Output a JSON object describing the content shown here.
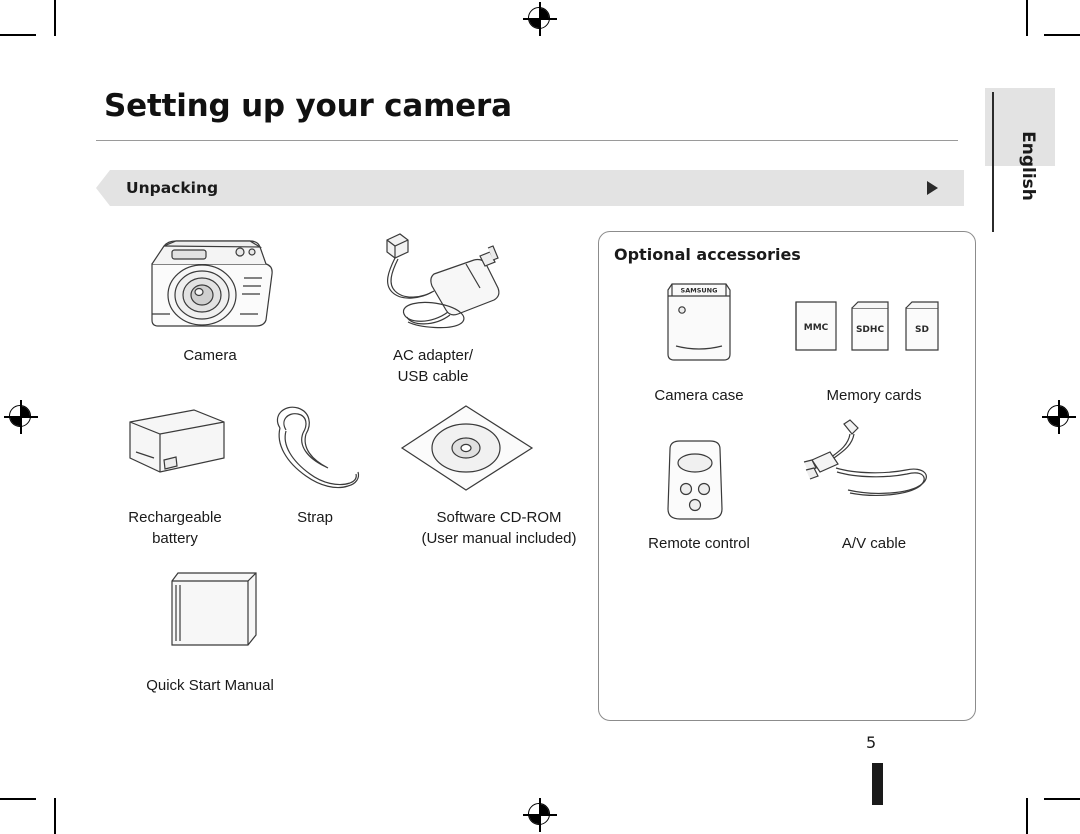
{
  "page": {
    "title": "Setting up your camera",
    "section_label": "Unpacking",
    "language_tab": "English",
    "page_number": "5"
  },
  "unpacking_items": [
    {
      "id": "camera",
      "caption": "Camera"
    },
    {
      "id": "ac-adapter-usb-cable",
      "caption": "AC adapter/\nUSB cable"
    },
    {
      "id": "rechargeable-battery",
      "caption": "Rechargeable\nbattery"
    },
    {
      "id": "strap",
      "caption": "Strap"
    },
    {
      "id": "software-cd-rom",
      "caption": "Software CD-ROM\n(User manual included)"
    },
    {
      "id": "quick-start-manual",
      "caption": "Quick Start Manual"
    }
  ],
  "optional_accessories": {
    "title": "Optional accessories",
    "items": [
      {
        "id": "camera-case",
        "caption": "Camera case",
        "brand": "SAMSUNG"
      },
      {
        "id": "memory-cards",
        "caption": "Memory cards",
        "card_labels": [
          "MMC",
          "SDHC",
          "SD"
        ]
      },
      {
        "id": "remote-control",
        "caption": "Remote control"
      },
      {
        "id": "av-cable",
        "caption": "A/V cable"
      }
    ]
  }
}
